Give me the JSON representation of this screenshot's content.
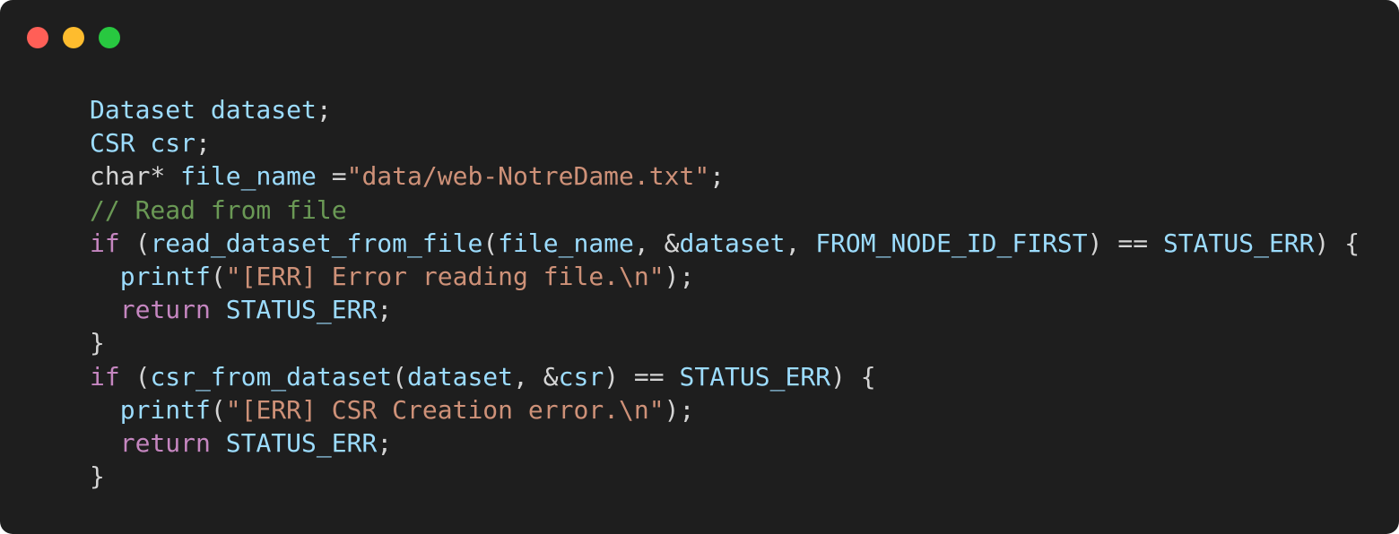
{
  "window": {
    "controls": {
      "close_color": "#ff5f57",
      "minimize_color": "#febc2e",
      "maximize_color": "#28c840"
    }
  },
  "code": {
    "lines": [
      [
        {
          "t": "Dataset dataset",
          "c": "type"
        },
        {
          "t": ";",
          "c": "plain"
        }
      ],
      [
        {
          "t": "CSR csr",
          "c": "type"
        },
        {
          "t": ";",
          "c": "plain"
        }
      ],
      [
        {
          "t": "char* ",
          "c": "plain"
        },
        {
          "t": "file_name",
          "c": "type"
        },
        {
          "t": " =",
          "c": "plain"
        },
        {
          "t": "\"data/web-NotreDame.txt\"",
          "c": "str"
        },
        {
          "t": ";",
          "c": "plain"
        }
      ],
      [
        {
          "t": "// Read from file",
          "c": "comment"
        }
      ],
      [
        {
          "t": "if",
          "c": "kw"
        },
        {
          "t": " (",
          "c": "plain"
        },
        {
          "t": "read_dataset_from_file",
          "c": "fn"
        },
        {
          "t": "(",
          "c": "plain"
        },
        {
          "t": "file_name",
          "c": "type"
        },
        {
          "t": ", &",
          "c": "plain"
        },
        {
          "t": "dataset",
          "c": "type"
        },
        {
          "t": ", ",
          "c": "plain"
        },
        {
          "t": "FROM_NODE_ID_FIRST",
          "c": "const"
        },
        {
          "t": ") == ",
          "c": "plain"
        },
        {
          "t": "STATUS_ERR",
          "c": "const"
        },
        {
          "t": ") {",
          "c": "plain"
        }
      ],
      [
        {
          "t": "  ",
          "c": "plain"
        },
        {
          "t": "printf",
          "c": "fn"
        },
        {
          "t": "(",
          "c": "plain"
        },
        {
          "t": "\"[ERR] Error reading file.\\n\"",
          "c": "str"
        },
        {
          "t": ");",
          "c": "plain"
        }
      ],
      [
        {
          "t": "  ",
          "c": "plain"
        },
        {
          "t": "return",
          "c": "kw"
        },
        {
          "t": " ",
          "c": "plain"
        },
        {
          "t": "STATUS_ERR",
          "c": "const"
        },
        {
          "t": ";",
          "c": "plain"
        }
      ],
      [
        {
          "t": "}",
          "c": "plain"
        }
      ],
      [
        {
          "t": "if",
          "c": "kw"
        },
        {
          "t": " (",
          "c": "plain"
        },
        {
          "t": "csr_from_dataset",
          "c": "fn"
        },
        {
          "t": "(",
          "c": "plain"
        },
        {
          "t": "dataset",
          "c": "type"
        },
        {
          "t": ", &",
          "c": "plain"
        },
        {
          "t": "csr",
          "c": "type"
        },
        {
          "t": ") == ",
          "c": "plain"
        },
        {
          "t": "STATUS_ERR",
          "c": "const"
        },
        {
          "t": ") {",
          "c": "plain"
        }
      ],
      [
        {
          "t": "  ",
          "c": "plain"
        },
        {
          "t": "printf",
          "c": "fn"
        },
        {
          "t": "(",
          "c": "plain"
        },
        {
          "t": "\"[ERR] CSR Creation error.\\n\"",
          "c": "str"
        },
        {
          "t": ");",
          "c": "plain"
        }
      ],
      [
        {
          "t": "  ",
          "c": "plain"
        },
        {
          "t": "return",
          "c": "kw"
        },
        {
          "t": " ",
          "c": "plain"
        },
        {
          "t": "STATUS_ERR",
          "c": "const"
        },
        {
          "t": ";",
          "c": "plain"
        }
      ],
      [
        {
          "t": "}",
          "c": "plain"
        }
      ]
    ]
  }
}
